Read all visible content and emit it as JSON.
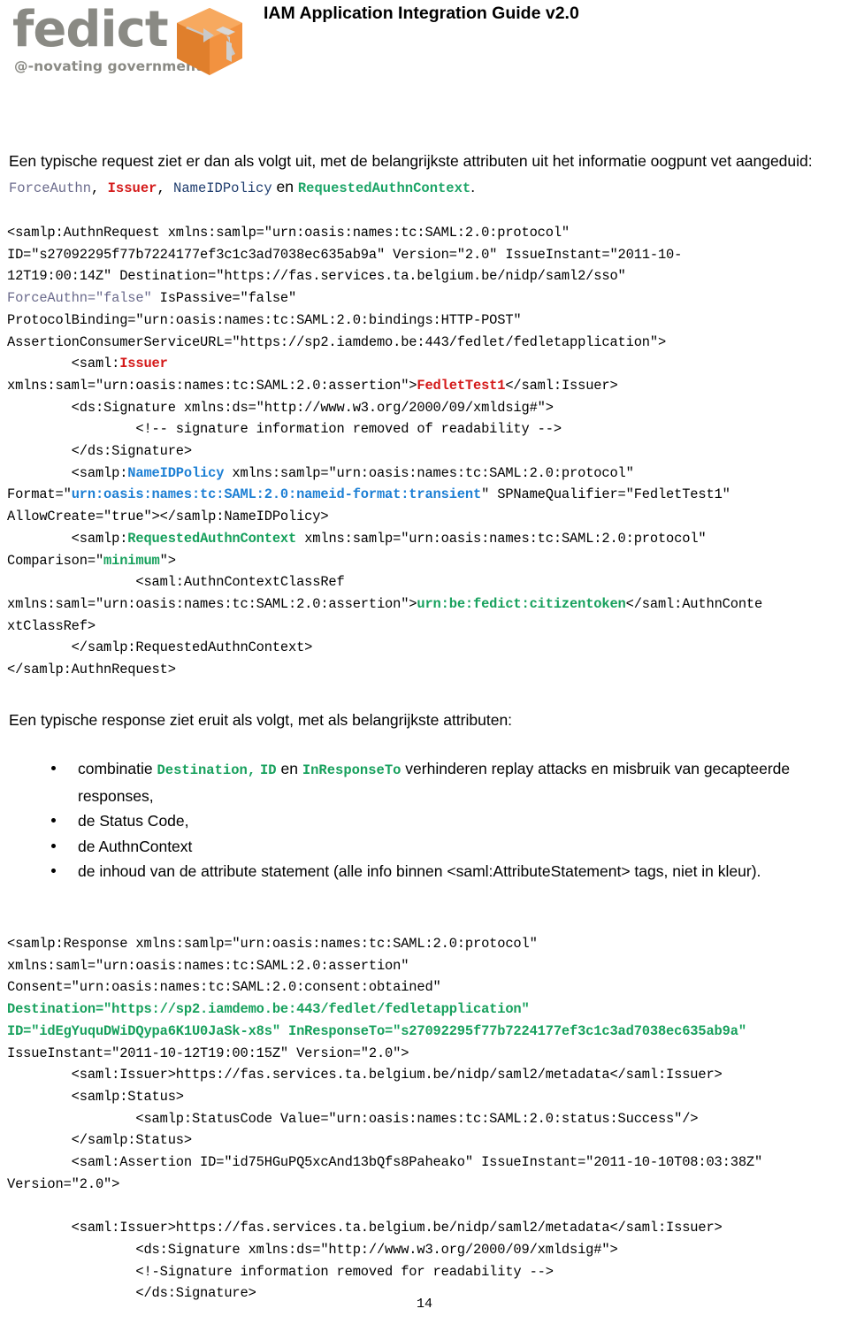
{
  "header": {
    "logo_text": "fedict",
    "logo_tagline": "@-novating government",
    "logo_icon": "orange-cube-logo-icon",
    "doc_title": "IAM Application Integration Guide v2.0"
  },
  "intro": {
    "line1": "Een typische request ziet er dan als volgt uit, met de belangrijkste attributen uit het informatie oogpunt vet",
    "line2_prefix": "aangeduid: ",
    "term_forceauthn": "ForceAuthn",
    "sep1": ", ",
    "term_issuer": "Issuer",
    "sep2": ", ",
    "term_nameidpolicy": "NameIDPolicy",
    "conj": " en ",
    "term_requestedauthncontext": "RequestedAuthnContext",
    "period": "."
  },
  "request_code": {
    "l1": "<samlp:AuthnRequest xmlns:samlp=\"urn:oasis:names:tc:SAML:2.0:protocol\"",
    "l2": "ID=\"s27092295f77b7224177ef3c1c3ad7038ec635ab9a\" Version=\"2.0\" IssueInstant=\"2011-10-",
    "l3": "12T19:00:14Z\" Destination=\"https://fas.services.ta.belgium.be/nidp/saml2/sso\"",
    "l4_force": "ForceAuthn=\"false\"",
    "l4_rest": " IsPassive=\"false\"",
    "l5": "ProtocolBinding=\"urn:oasis:names:tc:SAML:2.0:bindings:HTTP-POST\"",
    "l6": "AssertionConsumerServiceURL=\"https://sp2.iamdemo.be:443/fedlet/fedletapplication\">",
    "l7_indent": "        <saml:",
    "l7_issuer": "Issuer",
    "l8_pre": "xmlns:saml=\"urn:oasis:names:tc:SAML:2.0:assertion\">",
    "l8_val": "FedletTest1",
    "l8_post": "</saml:Issuer>",
    "l9": "        <ds:Signature xmlns:ds=\"http://www.w3.org/2000/09/xmldsig#\">",
    "l10": "                <!-- signature information removed of readability -->",
    "l11": "        </ds:Signature>",
    "l12_pre": "        <samlp:",
    "l12_tag": "NameIDPolicy",
    "l12_post": " xmlns:samlp=\"urn:oasis:names:tc:SAML:2.0:protocol\"",
    "l13_pre": "Format=\"",
    "l13_val": "urn:oasis:names:tc:SAML:2.0:nameid-format:transient",
    "l13_post": "\" SPNameQualifier=\"FedletTest1\"",
    "l14": "AllowCreate=\"true\"></samlp:NameIDPolicy>",
    "l15_pre": "        <samlp:",
    "l15_tag": "RequestedAuthnContext",
    "l15_post": " xmlns:samlp=\"urn:oasis:names:tc:SAML:2.0:protocol\"",
    "l16_pre": "Comparison=\"",
    "l16_val": "minimum",
    "l16_post": "\">",
    "l17": "                <saml:AuthnContextClassRef",
    "l18_pre": "xmlns:saml=\"urn:oasis:names:tc:SAML:2.0:assertion\">",
    "l18_val": "urn:be:fedict:citizentoken",
    "l18_post": "</saml:AuthnConte",
    "l19": "xtClassRef>",
    "l20": "        </samlp:RequestedAuthnContext>",
    "l21": "</samlp:AuthnRequest>"
  },
  "response_intro": "Een typische response ziet eruit als volgt, met als belangrijkste attributen:",
  "bullets": [
    {
      "pre": "combinatie ",
      "term1": "Destination,",
      "mid1": " ",
      "term2": "ID",
      "mid2": " en ",
      "term3": "InResponseTo",
      "post": " verhinderen replay attacks en misbruik van gecaptee<br>rde responses,",
      "text": "combinatie Destination, ID en InResponseTo verhinderen replay attacks en misbruik van gecapteerde responses,"
    },
    {
      "text": "de Status Code,"
    },
    {
      "text": "de AuthnContext"
    },
    {
      "text": "de inhoud van de attribute statement (alle info binnen <saml:AttributeStatement> tags, niet in kleur)."
    }
  ],
  "response_code": {
    "l1": "<samlp:Response xmlns:samlp=\"urn:oasis:names:tc:SAML:2.0:protocol\"",
    "l2": "xmlns:saml=\"urn:oasis:names:tc:SAML:2.0:assertion\"",
    "l3": "Consent=\"urn:oasis:names:tc:SAML:2.0:consent:obtained\"",
    "l4": "Destination=\"https://sp2.iamdemo.be:443/fedlet/fedletapplication\"",
    "l5": "ID=\"idEgYuquDWiDQypa6K1U0JaSk-x8s\" InResponseTo=\"s27092295f77b7224177ef3c1c3ad7038ec635ab9a\"",
    "l6": "IssueInstant=\"2011-10-12T19:00:15Z\" Version=\"2.0\">",
    "l7": "        <saml:Issuer>https://fas.services.ta.belgium.be/nidp/saml2/metadata</saml:Issuer>",
    "l8": "        <samlp:Status>",
    "l9": "                <samlp:StatusCode Value=\"urn:oasis:names:tc:SAML:2.0:status:Success\"/>",
    "l10": "        </samlp:Status>",
    "l11": "        <saml:Assertion ID=\"id75HGuPQ5xcAnd13bQfs8Paheako\" IssueInstant=\"2011-10-10T08:03:38Z\"",
    "l12": "Version=\"2.0\">",
    "l13": "",
    "l14": "        <saml:Issuer>https://fas.services.ta.belgium.be/nidp/saml2/metadata</saml:Issuer>",
    "l15": "                <ds:Signature xmlns:ds=\"http://www.w3.org/2000/09/xmldsig#\">",
    "l16": "                <!-Signature information removed for readability -->",
    "l17": "                </ds:Signature>"
  },
  "page_number": "14",
  "colors": {
    "logo_gray": "#8a8a84",
    "logo_orange": "#f29240",
    "red": "#d41919",
    "green": "#1da568",
    "blue": "#1c7fd4",
    "navy": "#1f3d6e",
    "purple": "#6b6b8c"
  }
}
